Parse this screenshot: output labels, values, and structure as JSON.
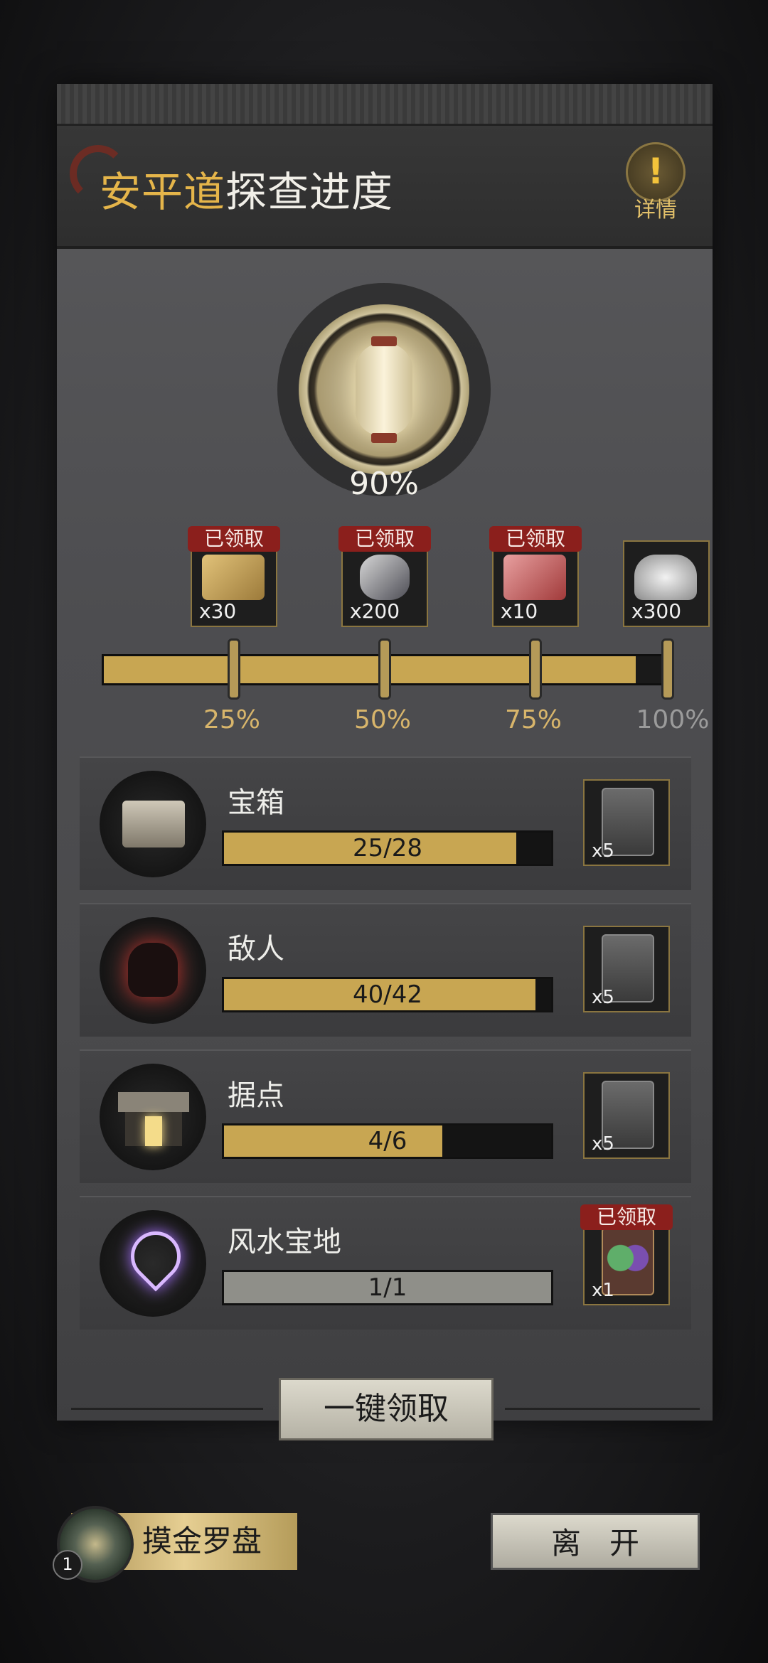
{
  "header": {
    "title_highlight": "安平道",
    "title_rest": "探查进度",
    "detail_label": "详情"
  },
  "overall": {
    "percent_label": "90%",
    "progress": 0.94
  },
  "milestones": [
    {
      "label": "25%",
      "quantity": "x30",
      "claimed_label": "已领取",
      "item": "gold-bar"
    },
    {
      "label": "50%",
      "quantity": "x200",
      "claimed_label": "已领取",
      "item": "silver-ore"
    },
    {
      "label": "75%",
      "quantity": "x10",
      "claimed_label": "已领取",
      "item": "red-ticket"
    },
    {
      "label": "100%",
      "quantity": "x300",
      "claimed_label": "",
      "item": "silver-ingot"
    }
  ],
  "tasks": [
    {
      "name": "宝箱",
      "progress_text": "25/28",
      "fraction": 0.893,
      "reward_qty": "x5",
      "claimed_label": "",
      "icon": "treasure-chest-icon"
    },
    {
      "name": "敌人",
      "progress_text": "40/42",
      "fraction": 0.952,
      "reward_qty": "x5",
      "claimed_label": "",
      "icon": "demon-skull-icon"
    },
    {
      "name": "据点",
      "progress_text": "4/6",
      "fraction": 0.667,
      "reward_qty": "x5",
      "claimed_label": "",
      "icon": "stronghold-icon"
    },
    {
      "name": "风水宝地",
      "progress_text": "1/1",
      "fraction": 1.0,
      "reward_qty": "x1",
      "claimed_label": "已领取",
      "icon": "fengshui-pin-icon"
    }
  ],
  "buttons": {
    "collect_all": "一键领取",
    "compass": "摸金罗盘",
    "compass_badge": "1",
    "leave": "离开"
  },
  "colors": {
    "gold": "#c8a652",
    "highlight": "#e5b54a",
    "claimed_red": "#8b1f1c"
  }
}
